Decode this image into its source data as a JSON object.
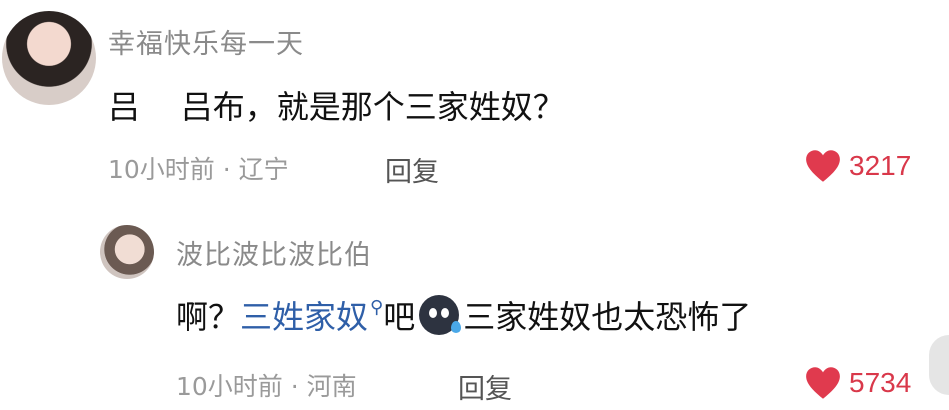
{
  "comments": [
    {
      "username": "幸福快乐每一天",
      "text": "吕    吕布，就是那个三家姓奴？",
      "meta": "10小时前 · 辽宁",
      "reply_label": "回复",
      "likes": "3217"
    },
    {
      "username": "波比波比波比伯",
      "text_before": "啊？",
      "link_text": "三姓家奴",
      "text_mid": "吧",
      "text_after": "三家姓奴也太恐怖了",
      "meta": "10小时前 · 河南",
      "reply_label": "回复",
      "likes": "5734"
    }
  ],
  "icons": {
    "like": "heart-icon",
    "search": "search-icon",
    "emoji": "sweat-emoji-icon"
  },
  "colors": {
    "like": "#e03a4e",
    "link": "#2f5fa8",
    "meta": "#9a9a9a"
  }
}
